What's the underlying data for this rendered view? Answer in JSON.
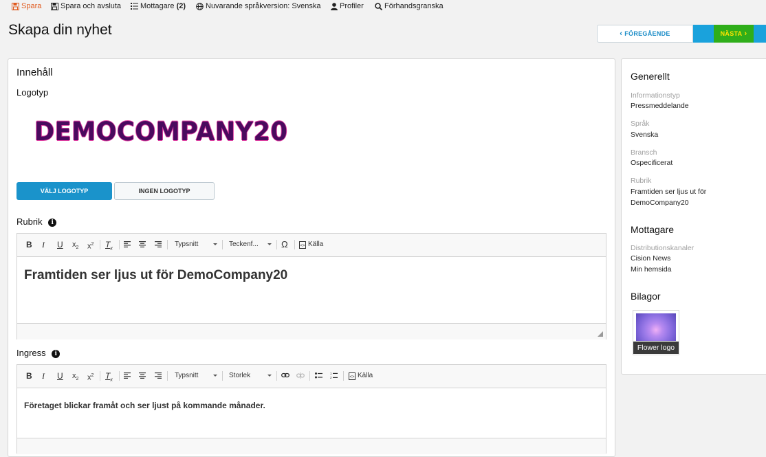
{
  "topbar": {
    "save": "Spara",
    "save_exit": "Spara och avsluta",
    "recipients_label": "Mottagare",
    "recipients_count": "(2)",
    "language": "Nuvarande språkversion: Svenska",
    "profiles": "Profiler",
    "preview": "Förhandsgranska"
  },
  "page": {
    "title": "Skapa din nyhet"
  },
  "nav": {
    "prev": "FÖREGÅENDE",
    "next": "NÄSTA"
  },
  "content": {
    "heading": "Innehåll",
    "logo_label": "Logotyp",
    "logo_text": "DEMOCOMPANY20",
    "choose_logo": "VÄLJ LOGOTYP",
    "no_logo": "INGEN LOGOTYP",
    "title_label": "Rubrik",
    "title_toolbar": {
      "font": "Typsnitt",
      "format": "Teckenf...",
      "source": "Källa"
    },
    "title_text": "Framtiden ser ljus ut för DemoCompany20",
    "lead_label": "Ingress",
    "lead_toolbar": {
      "font": "Typsnitt",
      "size": "Storlek",
      "source": "Källa"
    },
    "lead_text": "Företaget blickar framåt och ser ljust på kommande månader."
  },
  "sidebar": {
    "general_heading": "Generellt",
    "info_type_key": "Informationstyp",
    "info_type_val": "Pressmeddelande",
    "language_key": "Språk",
    "language_val": "Svenska",
    "industry_key": "Bransch",
    "industry_val": "Ospecificerat",
    "title_key": "Rubrik",
    "title_val_1": "Framtiden ser ljus ut för",
    "title_val_2": "DemoCompany20",
    "recipients_heading": "Mottagare",
    "channels_key": "Distributionskanaler",
    "channel_1": "Cision News",
    "channel_2": "Min hemsida",
    "attachments_heading": "Bilagor",
    "attachment_caption": "Flower logo"
  },
  "colors": {
    "accent_blue": "#1a93cb",
    "save_orange": "#e05a1e",
    "next_green": "#2fae1a",
    "next_text_yellow": "#ffe400"
  }
}
